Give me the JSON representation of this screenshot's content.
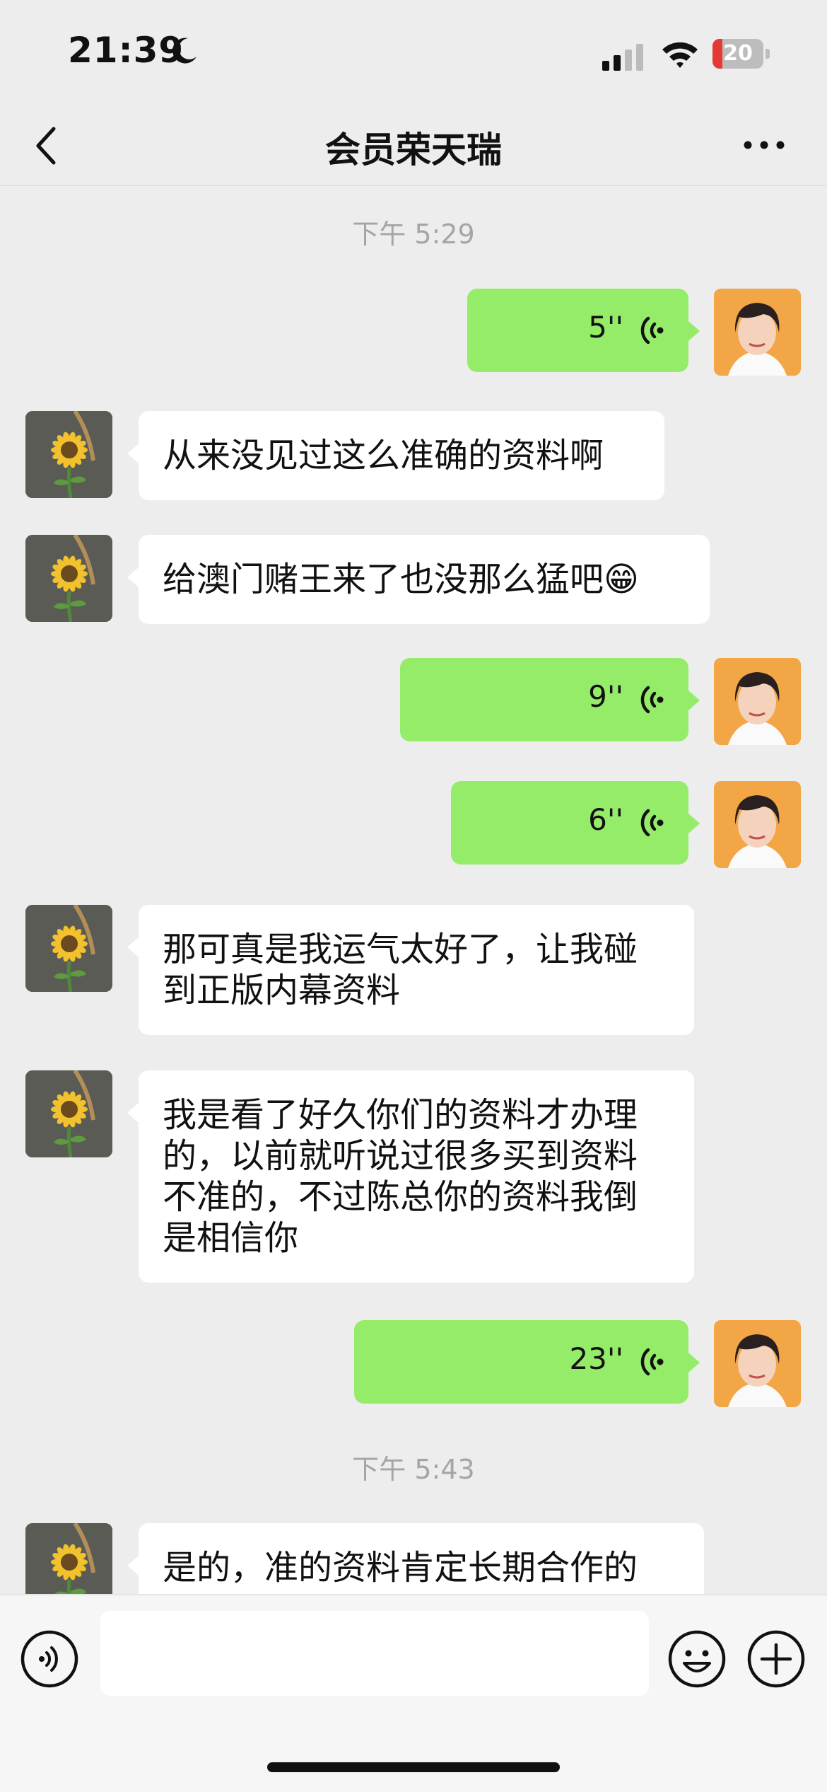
{
  "status_bar": {
    "time": "21:39",
    "battery": "20",
    "battery_level_percent": 20
  },
  "nav": {
    "title": "会员荣天瑞"
  },
  "chat": {
    "timestamps": [
      "下午 5:29",
      "下午 5:43"
    ],
    "messages": [
      {
        "from": "me",
        "type": "voice",
        "duration": "5''"
      },
      {
        "from": "other",
        "type": "text",
        "lines": [
          "从来没见过这么准确的资料啊"
        ]
      },
      {
        "from": "other",
        "type": "text",
        "lines": [
          "给澳门赌王来了也没那么猛吧😁"
        ]
      },
      {
        "from": "me",
        "type": "voice",
        "duration": "9''"
      },
      {
        "from": "me",
        "type": "voice",
        "duration": "6''"
      },
      {
        "from": "other",
        "type": "text",
        "lines": [
          "那可真是我运气太好了，让我碰",
          "到正版内幕资料"
        ]
      },
      {
        "from": "other",
        "type": "text",
        "lines": [
          "我是看了好久你们的资料才办理",
          "的，以前就听说过很多买到资料",
          "不准的，不过陈总你的资料我倒",
          "是相信你"
        ]
      },
      {
        "from": "me",
        "type": "voice",
        "duration": "23''"
      },
      {
        "from": "other",
        "type": "text",
        "lines": [
          "是的，准的资料肯定长期合作的"
        ]
      }
    ]
  },
  "input_bar": {
    "placeholder": ""
  },
  "icons": {
    "back": "chevron-left-icon",
    "more": "more-dots-icon",
    "voice": "voice-wave-icon",
    "emoji": "smiley-icon",
    "plus": "plus-circle-icon",
    "wifi": "wifi-icon",
    "signal": "cellular-signal-icon",
    "moon": "moon-icon"
  },
  "colors": {
    "outgoing_bubble": "#95ec69",
    "incoming_bubble": "#ffffff",
    "background": "#ededed"
  }
}
